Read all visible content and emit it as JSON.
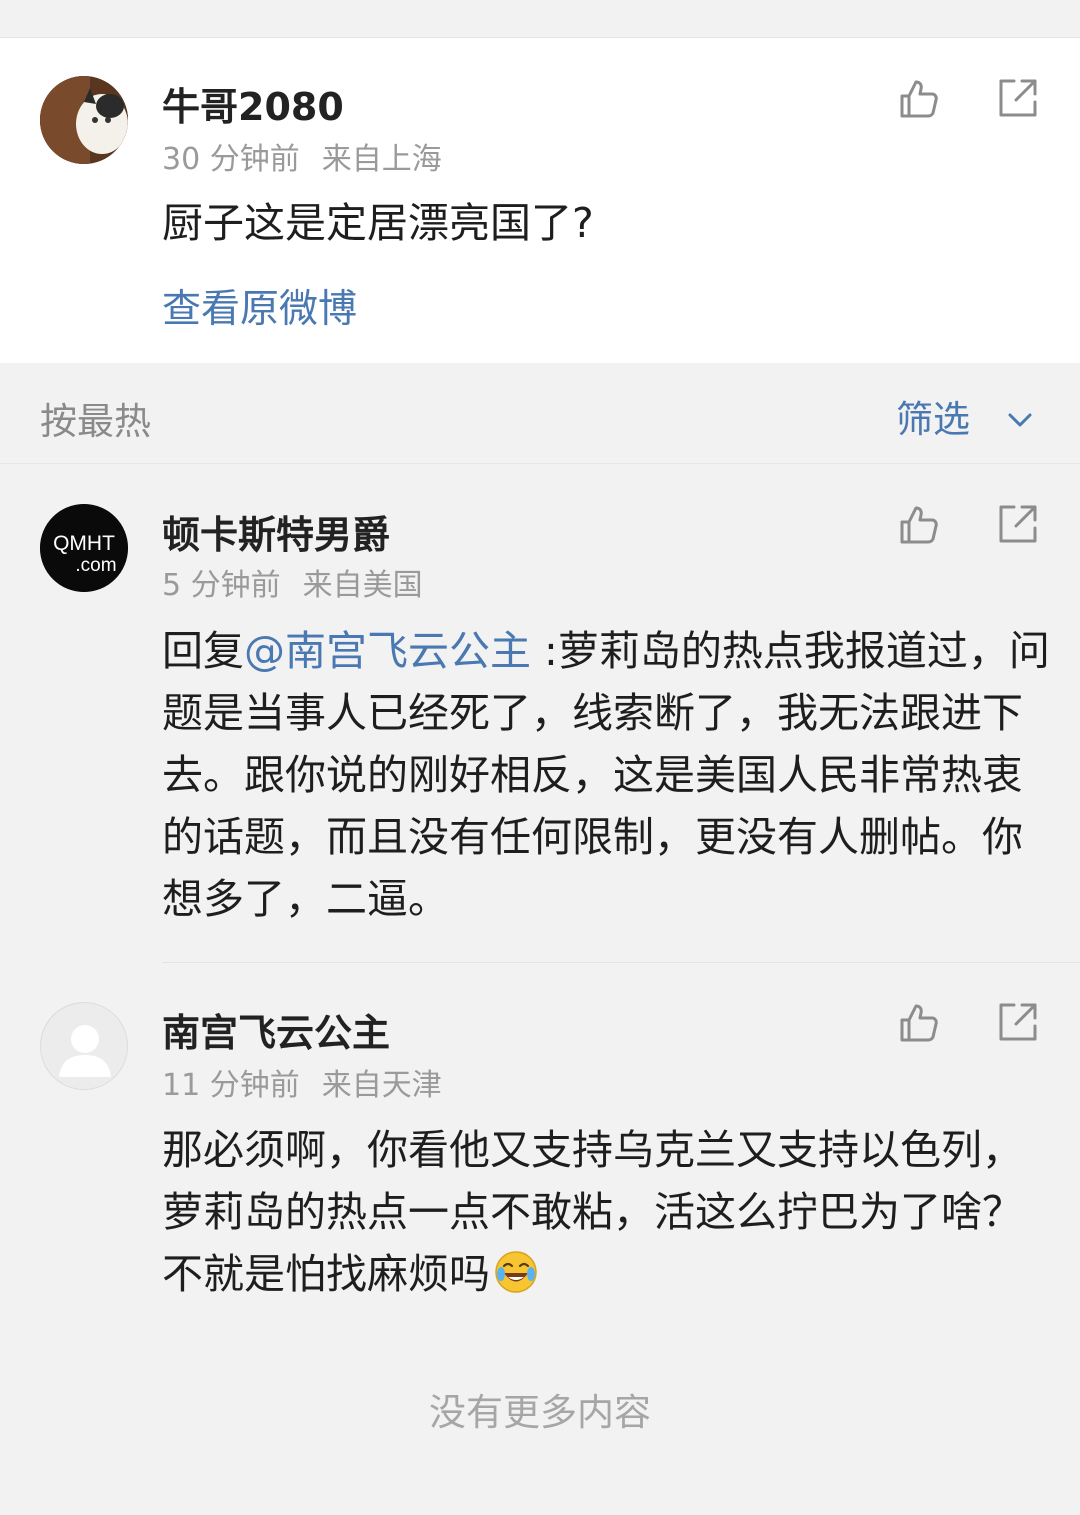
{
  "post": {
    "author": "牛哥2080",
    "time": "30 分钟前",
    "location": "来自上海",
    "text": "厨子这是定居漂亮国了?",
    "view_original": "查看原微博"
  },
  "sortbar": {
    "sort_label": "按最热",
    "filter_label": "筛选"
  },
  "comments": [
    {
      "author": "顿卡斯特男爵",
      "time": "5 分钟前",
      "location": "来自美国",
      "avatar_text_line1": "QMHT",
      "avatar_text_line2": ".com",
      "reply_prefix": "回复",
      "mention": "@南宫飞云公主",
      "text": " :萝莉岛的热点我报道过，问题是当事人已经死了，线索断了，我无法跟进下去。跟你说的刚好相反，这是美国人民非常热衷的话题，而且没有任何限制，更没有人删帖。你想多了，二逼。"
    },
    {
      "author": "南宫飞云公主",
      "time": "11 分钟前",
      "location": "来自天津",
      "text": "那必须啊，你看他又支持乌克兰又支持以色列，萝莉岛的热点一点不敢粘，活这么拧巴为了啥？不就是怕找麻烦吗"
    }
  ],
  "footer": {
    "no_more": "没有更多内容"
  },
  "colors": {
    "link": "#4a78b2",
    "meta": "#9a9a9a",
    "page_bg": "#f2f2f2"
  },
  "icons": [
    "like-icon",
    "share-icon",
    "chevron-down-icon",
    "laugh-cry-emoji-icon",
    "default-avatar-icon"
  ]
}
